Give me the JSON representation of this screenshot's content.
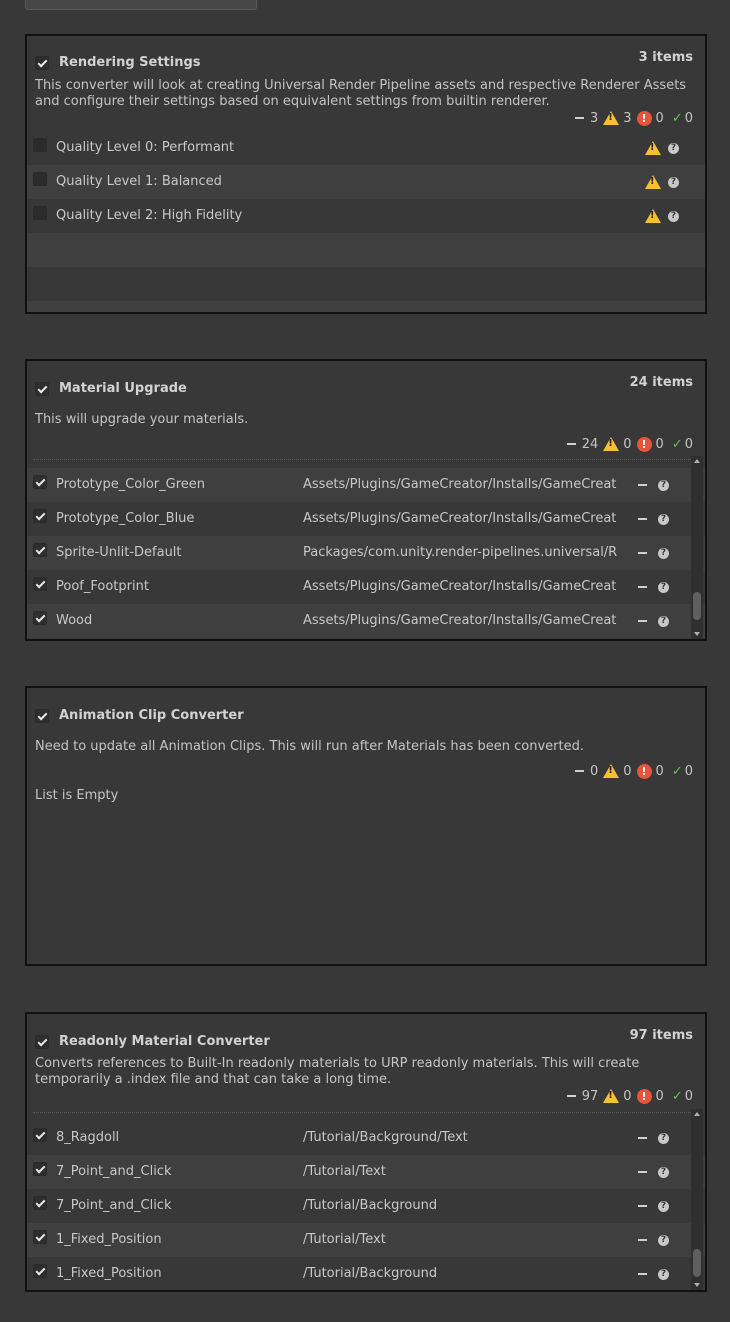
{
  "colors": {
    "warning": "#f5c130",
    "error": "#e5553c",
    "success": "#5fc84a",
    "panel_border": "#111111"
  },
  "panels": [
    {
      "title": "Rendering Settings",
      "count": "3 items",
      "enabled": true,
      "description": "This converter will look at creating Universal Render Pipeline assets and respective Renderer Assets and configure their settings based on equivalent settings from builtin renderer.",
      "stats": {
        "pending": "3",
        "warnings": "3",
        "errors": "0",
        "success": "0"
      },
      "rows": [
        {
          "name": "Quality Level 0: Performant",
          "checked": false,
          "status_icon": "warning-icon"
        },
        {
          "name": "Quality Level 1: Balanced",
          "checked": false,
          "status_icon": "warning-icon"
        },
        {
          "name": "Quality Level 2: High Fidelity",
          "checked": false,
          "status_icon": "warning-icon"
        }
      ]
    },
    {
      "title": "Material Upgrade",
      "count": "24 items",
      "enabled": true,
      "description": "This will upgrade your materials.",
      "stats": {
        "pending": "24",
        "warnings": "0",
        "errors": "0",
        "success": "0"
      },
      "rows": [
        {
          "name": "Prototype_Color_Green",
          "path": "Assets/Plugins/GameCreator/Installs/GameCreator",
          "checked": true
        },
        {
          "name": "Prototype_Color_Blue",
          "path": "Assets/Plugins/GameCreator/Installs/GameCreator",
          "checked": true
        },
        {
          "name": "Sprite-Unlit-Default",
          "path": "Packages/com.unity.render-pipelines.universal/Runtime",
          "checked": true
        },
        {
          "name": "Poof_Footprint",
          "path": "Assets/Plugins/GameCreator/Installs/GameCreator",
          "checked": true
        },
        {
          "name": "Wood",
          "path": "Assets/Plugins/GameCreator/Installs/GameCreator",
          "checked": true
        }
      ]
    },
    {
      "title": "Animation Clip Converter",
      "count": "",
      "enabled": true,
      "description": "Need to update all Animation Clips. This will run after Materials has been converted.",
      "stats": {
        "pending": "0",
        "warnings": "0",
        "errors": "0",
        "success": "0"
      },
      "empty_text": "List is Empty"
    },
    {
      "title": "Readonly Material Converter",
      "count": "97 items",
      "enabled": true,
      "description": "Converts references to Built-In readonly materials to URP readonly materials. This will create temporarily a .index file and that can take a long time.",
      "stats": {
        "pending": "97",
        "warnings": "0",
        "errors": "0",
        "success": "0"
      },
      "rows": [
        {
          "name": "8_Ragdoll",
          "path": "/Tutorial/Background/Text",
          "checked": true
        },
        {
          "name": "7_Point_and_Click",
          "path": "/Tutorial/Text",
          "checked": true
        },
        {
          "name": "7_Point_and_Click",
          "path": "/Tutorial/Background",
          "checked": true
        },
        {
          "name": "1_Fixed_Position",
          "path": "/Tutorial/Text",
          "checked": true
        },
        {
          "name": "1_Fixed_Position",
          "path": "/Tutorial/Background",
          "checked": true
        }
      ]
    }
  ]
}
